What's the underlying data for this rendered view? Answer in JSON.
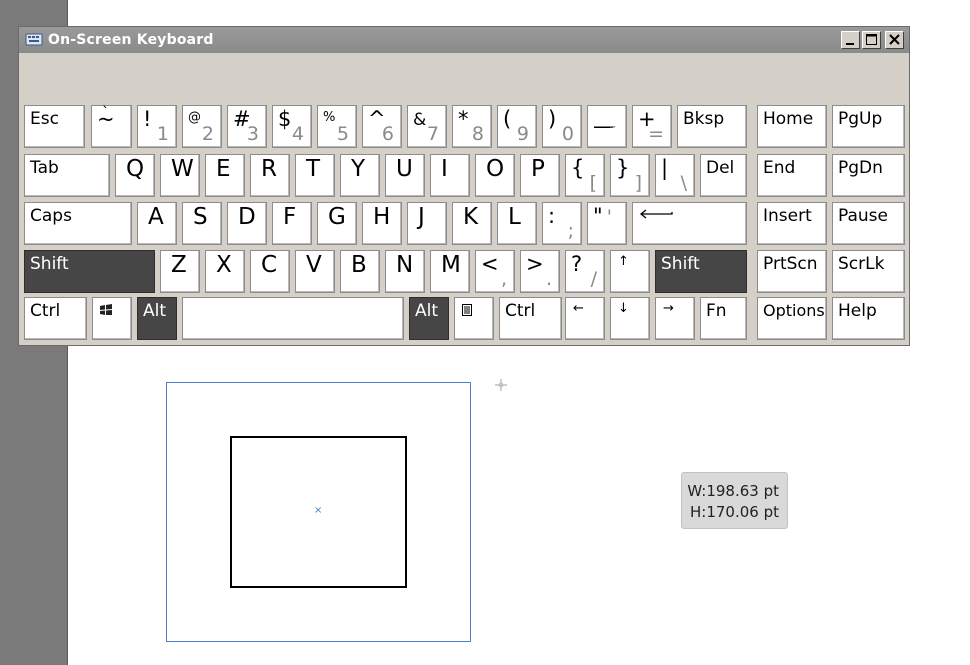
{
  "window": {
    "title": "On-Screen Keyboard"
  },
  "keys": {
    "esc": "Esc",
    "tilde_top": "~",
    "tilde_bot": "`",
    "n1_top": "!",
    "n1_bot": "1",
    "n2_top": "@",
    "n2_bot": "2",
    "n3_top": "#",
    "n3_bot": "3",
    "n4_top": "$",
    "n4_bot": "4",
    "n5_top": "%",
    "n5_bot": "5",
    "n6_top": "^",
    "n6_bot": "6",
    "n7_top": "&",
    "n7_bot": "7",
    "n8_top": "*",
    "n8_bot": "8",
    "n9_top": "(",
    "n9_bot": "9",
    "n0_top": ")",
    "n0_bot": "0",
    "minus_top": "—",
    "minus_bot": "-",
    "plus_top": "+",
    "plus_bot": "=",
    "bksp": "Bksp",
    "home": "Home",
    "pgup": "PgUp",
    "tab": "Tab",
    "q": "Q",
    "w": "W",
    "e": "E",
    "r": "R",
    "t": "T",
    "y": "Y",
    "u": "U",
    "i": "I",
    "o": "O",
    "p": "P",
    "lbrace_top": "{",
    "lbrace_bot": "[",
    "rbrace_top": "}",
    "rbrace_bot": "]",
    "pipe_top": "|",
    "pipe_bot": "\\",
    "del": "Del",
    "end": "End",
    "pgdn": "PgDn",
    "caps": "Caps",
    "a": "A",
    "s": "S",
    "d": "D",
    "f": "F",
    "g": "G",
    "h": "H",
    "j": "J",
    "k": "K",
    "l": "L",
    "colon_top": ":",
    "colon_bot": ";",
    "quote_top": "\"",
    "quote_bot": "'",
    "insert": "Insert",
    "pause": "Pause",
    "shift": "Shift",
    "z": "Z",
    "x": "X",
    "c": "C",
    "v": "V",
    "b": "B",
    "n": "N",
    "m": "M",
    "lt_top": "<",
    "lt_bot": ",",
    "gt_top": ">",
    "gt_bot": ".",
    "q_top": "?",
    "q_bot": "/",
    "up": "↑",
    "prtscn": "PrtScn",
    "scrlk": "ScrLk",
    "ctrl": "Ctrl",
    "alt": "Alt",
    "left": "←",
    "down": "↓",
    "right": "→",
    "fn": "Fn",
    "options": "Options",
    "help": "Help"
  },
  "dimensions": {
    "width": "W:198.63 pt",
    "height": "H:170.06 pt"
  },
  "colors": {
    "titlebar": "#8f8f8f",
    "keyboard_bg": "#d4d0c8",
    "key": "#ffffff",
    "key_active": "#464646",
    "artboard_border": "#4a7ec7"
  }
}
